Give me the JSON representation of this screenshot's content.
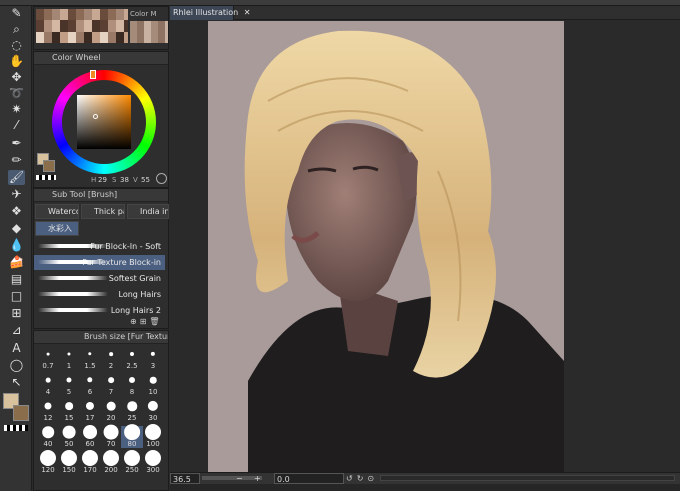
{
  "canvas_tab": {
    "title": "Rhlei Illustration",
    "close": "✕"
  },
  "color_set": {
    "label": "Color M"
  },
  "color_wheel": {
    "title": "Color Wheel",
    "values": [
      "29",
      "38",
      "55"
    ],
    "hsv_labels": [
      "H",
      "S",
      "V"
    ],
    "main_color": "#d8c29e",
    "sub_color": "#8a6d4a"
  },
  "sub_tool": {
    "title": "Sub Tool [Brush]",
    "tabs": [
      "Watercolor",
      "Thick paint",
      "India ink",
      "水彩入"
    ],
    "brushes": [
      "Fur Block-In - Soft",
      "Fur Texture Block-in",
      "Softest Grain",
      "Long Hairs",
      "Long Hairs 2"
    ],
    "selected_index": 1
  },
  "brush_size": {
    "title": "Brush size [Fur Texture Block-",
    "sizes": [
      "0.7",
      "1",
      "1.5",
      "2",
      "2.5",
      "3",
      "4",
      "5",
      "6",
      "7",
      "8",
      "10",
      "12",
      "15",
      "17",
      "20",
      "25",
      "30",
      "40",
      "50",
      "60",
      "70",
      "80",
      "100",
      "120",
      "150",
      "170",
      "200",
      "250",
      "300"
    ],
    "selected": "80"
  },
  "status": {
    "zoom": "36.5",
    "angle": "0.0"
  },
  "icons": [
    "pen-icon",
    "search-icon",
    "move-icon",
    "lasso-icon",
    "eyedropper-icon",
    "brush-icon",
    "eraser-icon",
    "fill-icon",
    "gradient-icon",
    "text-icon"
  ]
}
